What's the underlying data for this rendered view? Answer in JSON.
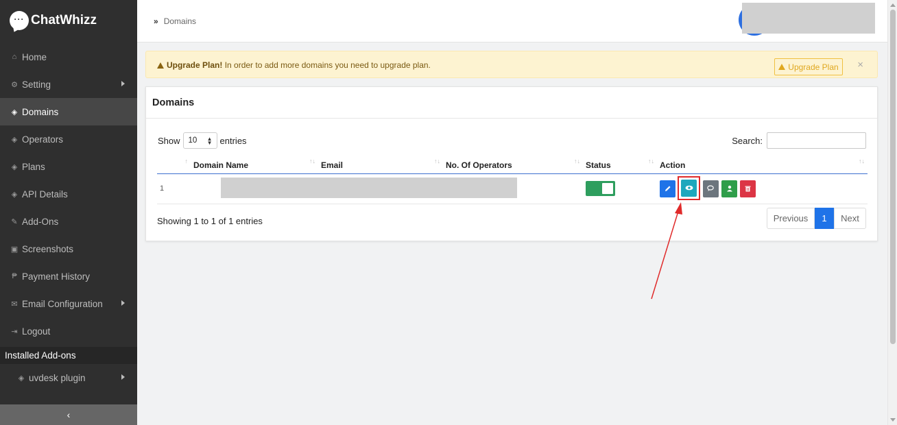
{
  "brand": {
    "name": "ChatWhizz",
    "logo_text": "···"
  },
  "sidebar": {
    "items": [
      {
        "label": "Home",
        "icon": "home-icon",
        "glyph": "⌂"
      },
      {
        "label": "Setting",
        "icon": "gears-icon",
        "glyph": "⚙"
      },
      {
        "label": "Domains",
        "icon": "cube-icon",
        "glyph": "◈"
      },
      {
        "label": "Operators",
        "icon": "cube-icon",
        "glyph": "◈"
      },
      {
        "label": "Plans",
        "icon": "cube-icon",
        "glyph": "◈"
      },
      {
        "label": "API Details",
        "icon": "cube-icon",
        "glyph": "◈"
      },
      {
        "label": "Add-Ons",
        "icon": "wrench-icon",
        "glyph": "✎"
      },
      {
        "label": "Screenshots",
        "icon": "image-icon",
        "glyph": "▣"
      },
      {
        "label": "Payment History",
        "icon": "paypal-icon",
        "glyph": "₱"
      },
      {
        "label": "Email Configuration",
        "icon": "envelope-icon",
        "glyph": "✉"
      },
      {
        "label": "Logout",
        "icon": "sign-out-icon",
        "glyph": "⇥"
      }
    ],
    "section_title": "Installed Add-ons",
    "addons": [
      {
        "label": "uvdesk plugin",
        "icon": "cube-icon",
        "glyph": "◈"
      }
    ],
    "collapse_glyph": "‹"
  },
  "header": {
    "breadcrumb_chevron": "»",
    "breadcrumb": "Domains"
  },
  "alert": {
    "title": "Upgrade Plan!",
    "message": " In order to add more domains you need to upgrade plan.",
    "button_label": "Upgrade Plan",
    "close_glyph": "×"
  },
  "card": {
    "title": "Domains",
    "show_label": "Show",
    "entries_label": "entries",
    "page_length": "10",
    "search_label": "Search:",
    "search_value": "",
    "columns": [
      "",
      "Domain Name",
      "Email",
      "No. Of Operators",
      "Status",
      "Action"
    ],
    "rows": [
      {
        "index": "1",
        "status_on": true
      }
    ],
    "info": "Showing 1 to 1 of 1 entries",
    "pager": {
      "previous": "Previous",
      "current": "1",
      "next": "Next"
    }
  },
  "colors": {
    "sidebar_bg": "#2f2f2f",
    "accent_blue": "#1f73e8",
    "view_button": "#1ea7bd",
    "status_green": "#2e9e5e",
    "annotation_red": "#e02a2a"
  }
}
